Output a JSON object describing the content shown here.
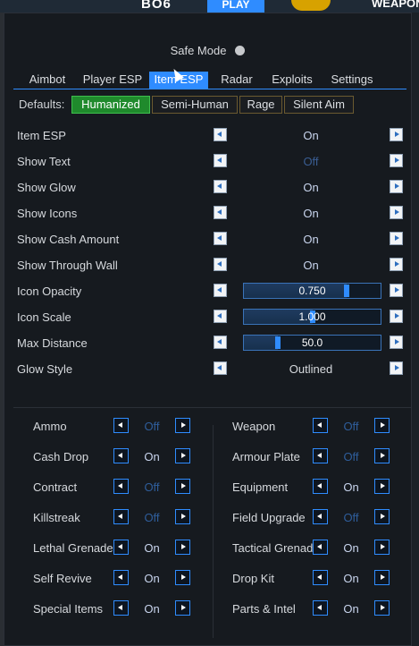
{
  "topbar": {
    "logo": "BO6",
    "play": "PLAY",
    "weapons": "WEAPONS"
  },
  "safe_mode": {
    "label": "Safe Mode",
    "enabled": false
  },
  "tabs": [
    {
      "label": "Aimbot"
    },
    {
      "label": "Player ESP"
    },
    {
      "label": "Item ESP",
      "active": true
    },
    {
      "label": "Radar"
    },
    {
      "label": "Exploits"
    },
    {
      "label": "Settings"
    }
  ],
  "defaults": {
    "label": "Defaults:",
    "presets": [
      {
        "label": "Humanized",
        "active": true
      },
      {
        "label": "Semi-Human"
      },
      {
        "label": "Rage"
      },
      {
        "label": "Silent Aim"
      }
    ]
  },
  "settings": [
    {
      "name": "Item ESP",
      "value": "On"
    },
    {
      "name": "Show Text",
      "value": "Off"
    },
    {
      "name": "Show Glow",
      "value": "On"
    },
    {
      "name": "Show Icons",
      "value": "On"
    },
    {
      "name": "Show Cash Amount",
      "value": "On"
    },
    {
      "name": "Show Through Wall",
      "value": "On"
    },
    {
      "name": "Icon Opacity",
      "value": "0.750",
      "slider": 0.75
    },
    {
      "name": "Icon Scale",
      "value": "1.000",
      "slider": 0.5
    },
    {
      "name": "Max Distance",
      "value": "50.0",
      "slider": 0.25
    },
    {
      "name": "Glow Style",
      "value": "Outlined"
    }
  ],
  "item_types_left": [
    {
      "name": "Ammo",
      "value": "Off"
    },
    {
      "name": "Cash Drop",
      "value": "On"
    },
    {
      "name": "Contract",
      "value": "Off"
    },
    {
      "name": "Killstreak",
      "value": "Off"
    },
    {
      "name": "Lethal Grenade",
      "value": "On"
    },
    {
      "name": "Self Revive",
      "value": "On"
    },
    {
      "name": "Special Items",
      "value": "On"
    }
  ],
  "item_types_right": [
    {
      "name": "Weapon",
      "value": "Off"
    },
    {
      "name": "Armour Plate",
      "value": "Off"
    },
    {
      "name": "Equipment",
      "value": "On"
    },
    {
      "name": "Field Upgrade",
      "value": "Off"
    },
    {
      "name": "Tactical Grenade",
      "value": "On"
    },
    {
      "name": "Drop Kit",
      "value": "On"
    },
    {
      "name": "Parts & Intel",
      "value": "On"
    }
  ],
  "colors": {
    "accent": "#2f8cff",
    "active_preset": "#1f8a2c",
    "off_text": "#3a5d92",
    "panel_bg": "#161a1f"
  }
}
